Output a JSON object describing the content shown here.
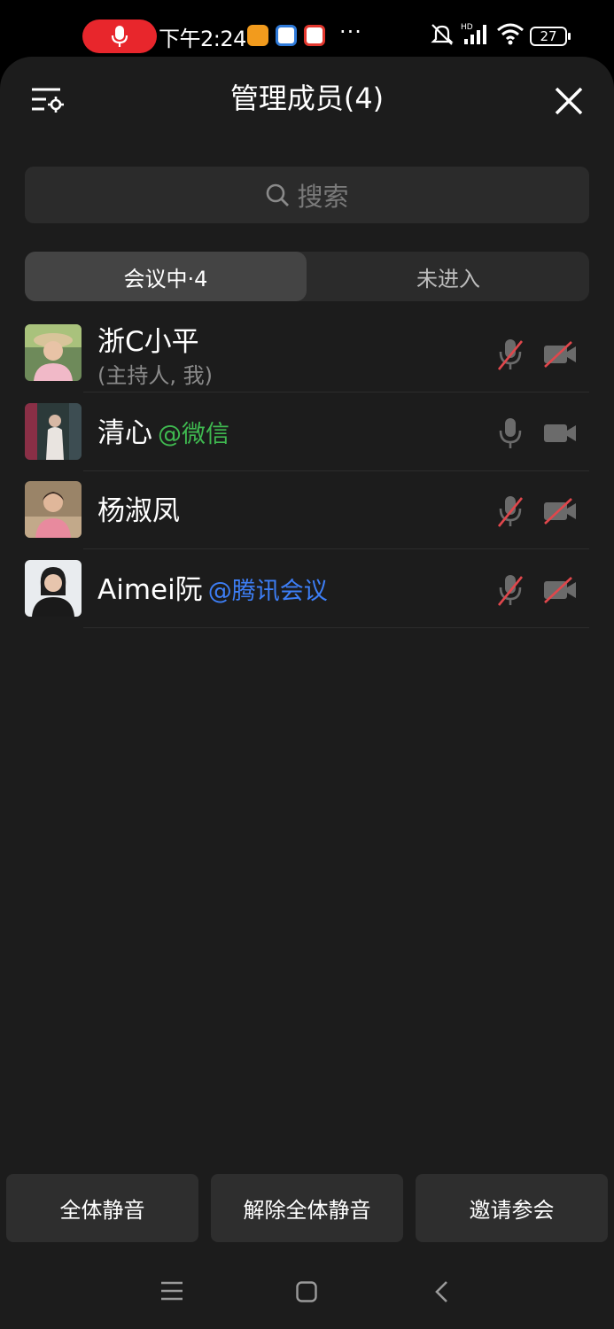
{
  "status_bar": {
    "time": "下午2:24",
    "dots": "···",
    "battery": "27"
  },
  "header": {
    "title": "管理成员(4)"
  },
  "search": {
    "placeholder": "搜索"
  },
  "tabs": [
    {
      "label": "会议中·4",
      "active": true
    },
    {
      "label": "未进入",
      "active": false
    }
  ],
  "members": [
    {
      "name": "浙C小平",
      "tag": "",
      "subtitle": "(主持人, 我)",
      "mic_muted": true,
      "camera_off": true
    },
    {
      "name": "清心",
      "tag": "@微信",
      "subtitle": "",
      "mic_muted": false,
      "camera_off": false
    },
    {
      "name": "杨淑凤",
      "tag": "",
      "subtitle": "",
      "mic_muted": true,
      "camera_off": true
    },
    {
      "name": "Aimei阮",
      "tag": "@腾讯会议",
      "subtitle": "",
      "mic_muted": true,
      "camera_off": true
    }
  ],
  "actions": {
    "mute_all": "全体静音",
    "unmute_all": "解除全体静音",
    "invite": "邀请参会"
  },
  "colors": {
    "accent_red": "#e8262c",
    "wechat_green": "#3fb950",
    "tencent_blue": "#3d7ef5",
    "sheet_bg": "#1c1c1c"
  }
}
